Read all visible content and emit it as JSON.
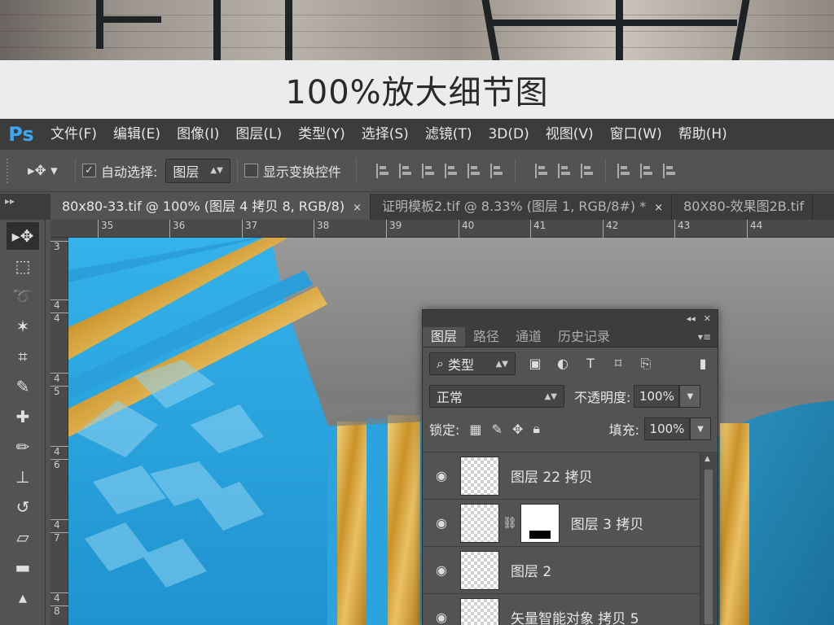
{
  "caption": "100%放大细节图",
  "app": {
    "logo": "Ps"
  },
  "menu": [
    "文件(F)",
    "编辑(E)",
    "图像(I)",
    "图层(L)",
    "类型(Y)",
    "选择(S)",
    "滤镜(T)",
    "3D(D)",
    "视图(V)",
    "窗口(W)",
    "帮助(H)"
  ],
  "options": {
    "auto_select_label": "自动选择:",
    "auto_select_checked": true,
    "auto_select_value": "图层",
    "show_transform_label": "显示变换控件",
    "show_transform_checked": false
  },
  "tabs": [
    {
      "label": "80x80-33.tif @ 100% (图层 4 拷贝 8, RGB/8)",
      "close": "×",
      "active": true
    },
    {
      "label": "证明模板2.tif @ 8.33% (图层 1, RGB/8#) *",
      "close": "×",
      "active": false
    },
    {
      "label": "80X80-效果图2B.tif",
      "close": "",
      "active": false
    }
  ],
  "ruler": {
    "horizontal": [
      "35",
      "36",
      "37",
      "38",
      "39",
      "40",
      "41",
      "42",
      "43",
      "44"
    ],
    "vertical": [
      "3",
      "4",
      "4",
      "4",
      "5",
      "4",
      "6",
      "4",
      "7",
      "4",
      "8"
    ]
  },
  "layers_panel": {
    "tabs": [
      "图层",
      "路径",
      "通道",
      "历史记录"
    ],
    "filter_label": "类型",
    "blend_mode": "正常",
    "opacity_label": "不透明度:",
    "opacity_value": "100%",
    "lock_label": "锁定:",
    "fill_label": "填充:",
    "fill_value": "100%",
    "layers": [
      {
        "name": "图层 22 拷贝",
        "has_mask": false
      },
      {
        "name": "图层 3 拷贝",
        "has_mask": true
      },
      {
        "name": "图层 2",
        "has_mask": false
      },
      {
        "name": "矢量智能对象 拷贝 5",
        "has_mask": false
      }
    ]
  },
  "colors": {
    "accent": "#41a6f0",
    "artwork_blue": "#2aa3df",
    "artwork_gold": "#d9a531"
  }
}
